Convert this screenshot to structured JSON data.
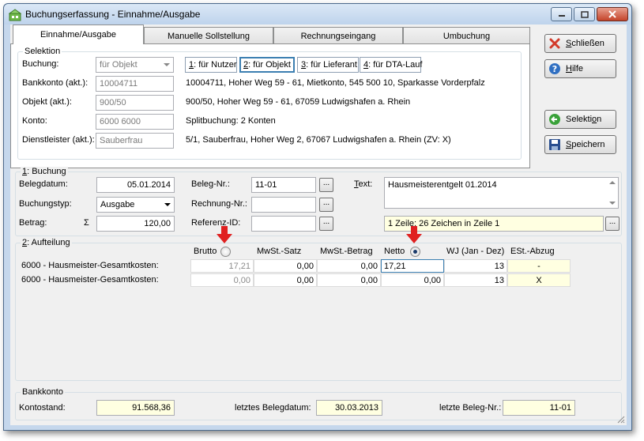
{
  "window": {
    "title": "Buchungserfassung - Einnahme/Ausgabe"
  },
  "tabs": [
    {
      "label": "Einnahme/Ausgabe"
    },
    {
      "label": "Manuelle Sollstellung"
    },
    {
      "label": "Rechnungseingang"
    },
    {
      "label": "Umbuchung"
    }
  ],
  "selektion": {
    "group_label": "Selektion",
    "buchung": {
      "label": "Buchung:",
      "value": "für Objekt"
    },
    "modes": [
      {
        "hotkey": "1",
        "label": ": für Nutzer"
      },
      {
        "hotkey": "2",
        "label": ": für Objekt"
      },
      {
        "hotkey": "3",
        "label": ": für Lieferant"
      },
      {
        "hotkey": "4",
        "label": ": für DTA-Lauf"
      }
    ],
    "bankkonto": {
      "label": "Bankkonto (akt.):",
      "value": "10004711",
      "desc": "10004711,  Hoher Weg 59 - 61,  Mietkonto,  545 500 10,  Sparkasse Vorderpfalz"
    },
    "objekt": {
      "label": "Objekt (akt.):",
      "value": "900/50",
      "desc": "900/50,  Hoher Weg 59 - 61, 67059 Ludwigshafen a. Rhein"
    },
    "konto": {
      "label": "Konto:",
      "value": "6000 6000",
      "desc": "Splitbuchung:  2 Konten"
    },
    "dienstleister": {
      "label": "Dienstleister (akt.):",
      "value": "Sauberfrau",
      "desc": "5/1,  Sauberfrau,  Hoher Weg 2, 67067 Ludwigshafen a. Rhein  (ZV: X)"
    }
  },
  "side_buttons": {
    "schliessen": {
      "pre": "",
      "hot": "S",
      "post": "chließen"
    },
    "hilfe": {
      "pre": "",
      "hot": "H",
      "post": "ilfe"
    },
    "selektion": {
      "pre": "Selekti",
      "hot": "o",
      "post": "n"
    },
    "speichern": {
      "pre": "",
      "hot": "S",
      "post": "peichern"
    }
  },
  "buchung": {
    "group_hot": "1",
    "group_label": ": Buchung",
    "belegdatum": {
      "label": "Belegdatum:",
      "value": "05.01.2014"
    },
    "buchungstyp": {
      "label": "Buchungstyp:",
      "value": "Ausgabe"
    },
    "betrag": {
      "label": "Betrag:",
      "sigma": "Σ",
      "value": "120,00"
    },
    "beleg_nr": {
      "label": "Beleg-Nr.:",
      "value": "11-01"
    },
    "rechnung_nr": {
      "label": "Rechnung-Nr.:",
      "value": ""
    },
    "referenz_id": {
      "label": "Referenz-ID:",
      "value": ""
    },
    "text": {
      "hot": "T",
      "label": "ext:",
      "value": "Hausmeisterentgelt 01.2014",
      "info": "1 Zeile; 26 Zeichen in Zeile 1"
    },
    "dots": "..."
  },
  "aufteilung": {
    "group_hot": "2",
    "group_label": ": Aufteilung",
    "headers": {
      "brutto": "Brutto",
      "mwst_satz": "MwSt.-Satz",
      "mwst_betrag": "MwSt.-Betrag",
      "netto": "Netto",
      "wj": "WJ (Jan - Dez)",
      "est": "ESt.-Abzug"
    },
    "rows": [
      {
        "konto": "6000 - Hausmeister-Gesamtkosten:",
        "brutto": "17,21",
        "mwst_satz": "0,00",
        "mwst_betrag": "0,00",
        "netto": "17,21",
        "wj": "13",
        "est": "-"
      },
      {
        "konto": "6000 - Hausmeister-Gesamtkosten:",
        "brutto": "0,00",
        "mwst_satz": "0,00",
        "mwst_betrag": "0,00",
        "netto": "0,00",
        "wj": "13",
        "est": "X"
      }
    ]
  },
  "bankkonto_footer": {
    "group_label": "Bankkonto",
    "kontostand": {
      "label": "Kontostand:",
      "value": "91.568,36"
    },
    "letztes_belegdatum": {
      "label": "letztes Belegdatum:",
      "value": "30.03.2013"
    },
    "letzte_beleg_nr": {
      "label": "letzte Beleg-Nr.:",
      "value": "11-01"
    }
  },
  "colors": {
    "accent": "#3c7fb1",
    "highlight_yellow": "#ffffe1",
    "arrow_red": "#e02020"
  }
}
